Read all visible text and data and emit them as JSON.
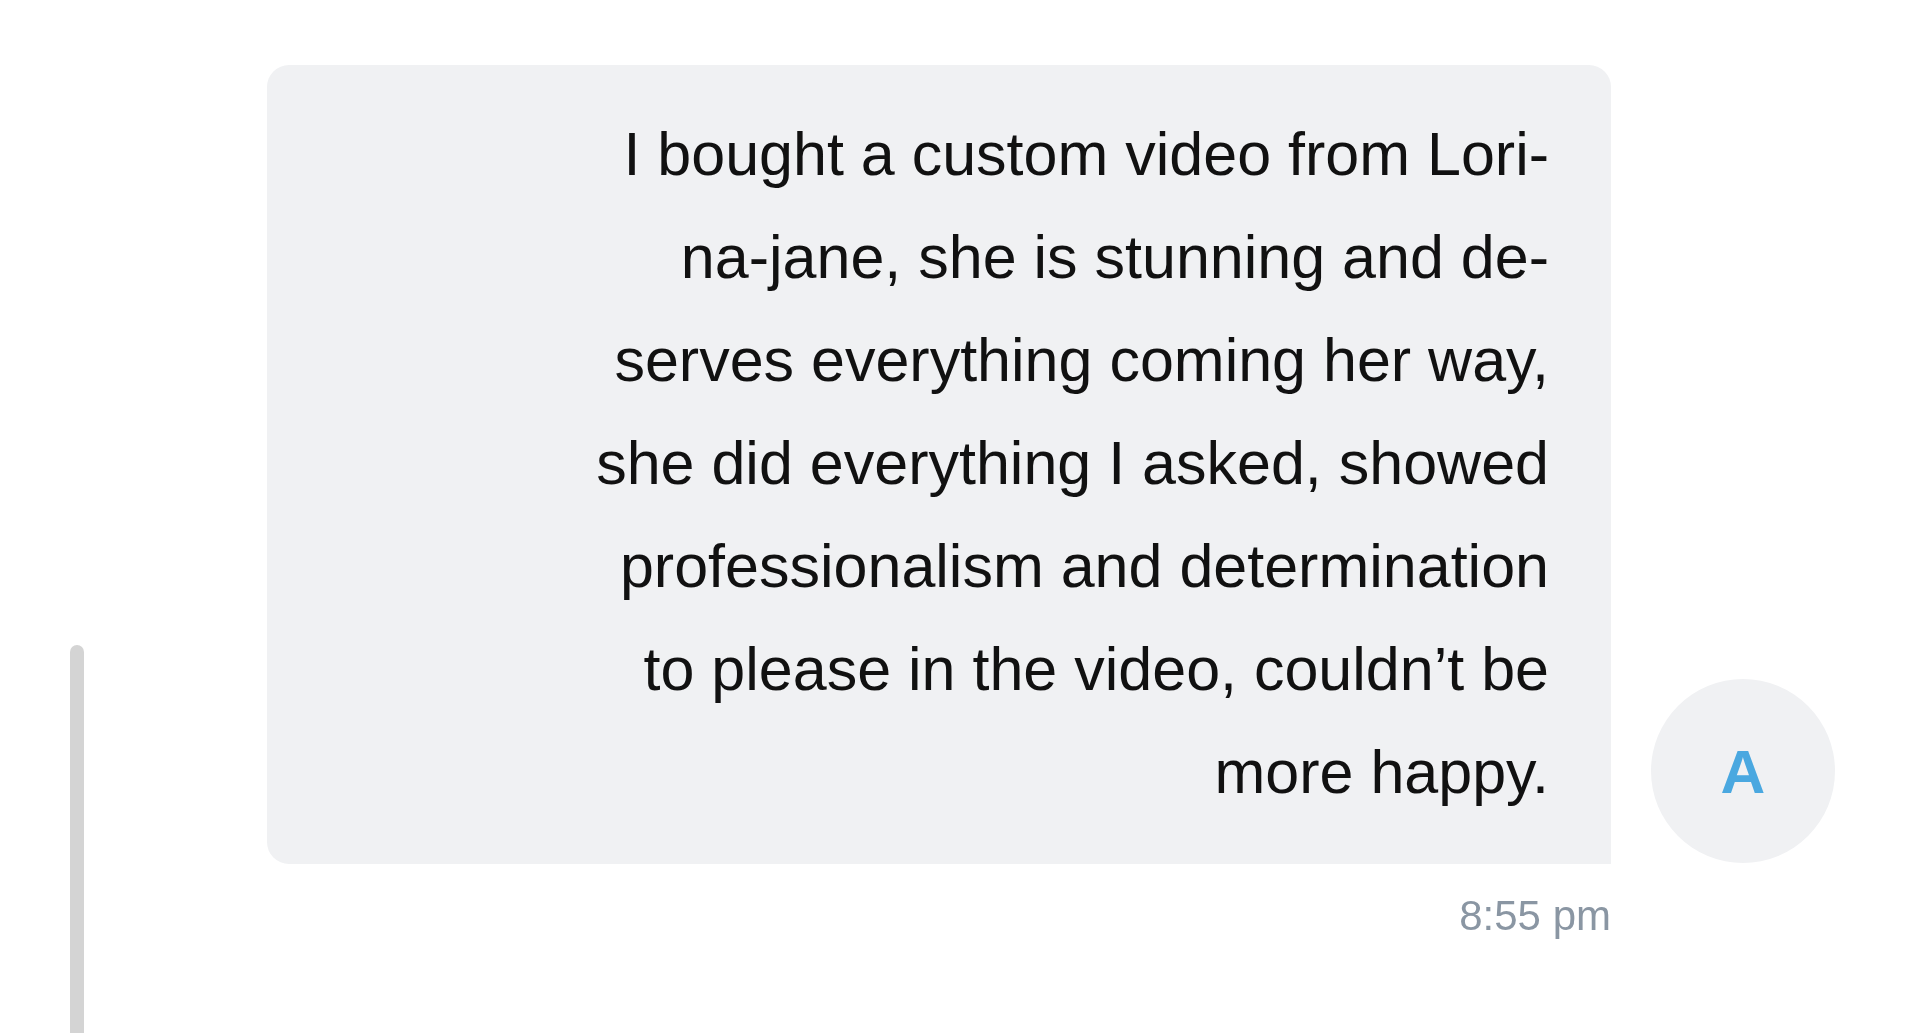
{
  "message": {
    "lines": [
      "I bought a custom video from Lori-",
      "na-jane, she is stunning and de-",
      "serves everything coming her way,",
      "she did everything I asked, showed",
      "professionalism and determination",
      "to please in the video, couldn’t be",
      "more happy."
    ],
    "time": "8:55 pm"
  },
  "avatar": {
    "initial": "A"
  }
}
